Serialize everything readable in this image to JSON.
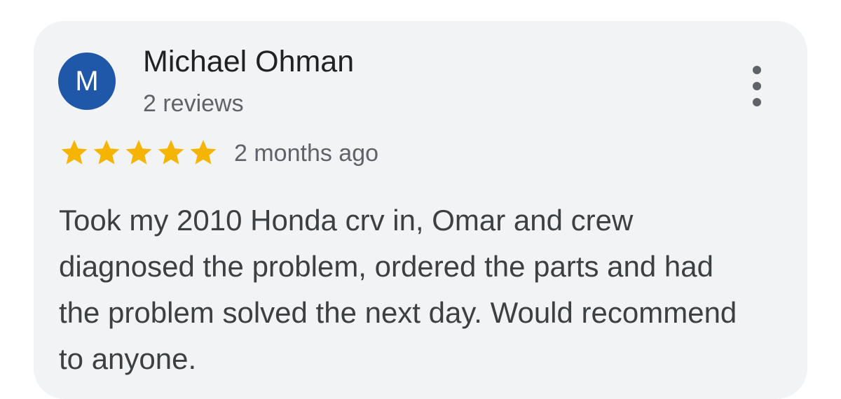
{
  "review": {
    "avatar_letter": "M",
    "avatar_color": "#1f58a8",
    "author_name": "Michael Ohman",
    "author_reviews": "2 reviews",
    "rating": 5,
    "rating_max": 5,
    "star_color": "#f4b400",
    "time_ago": "2 months ago",
    "text": "Took my 2010 Honda crv in, Omar and crew diagnosed the problem, ordered the parts and had the problem solved the next day. Would recommend to anyone.",
    "menu_icon": "more-vert-icon"
  }
}
